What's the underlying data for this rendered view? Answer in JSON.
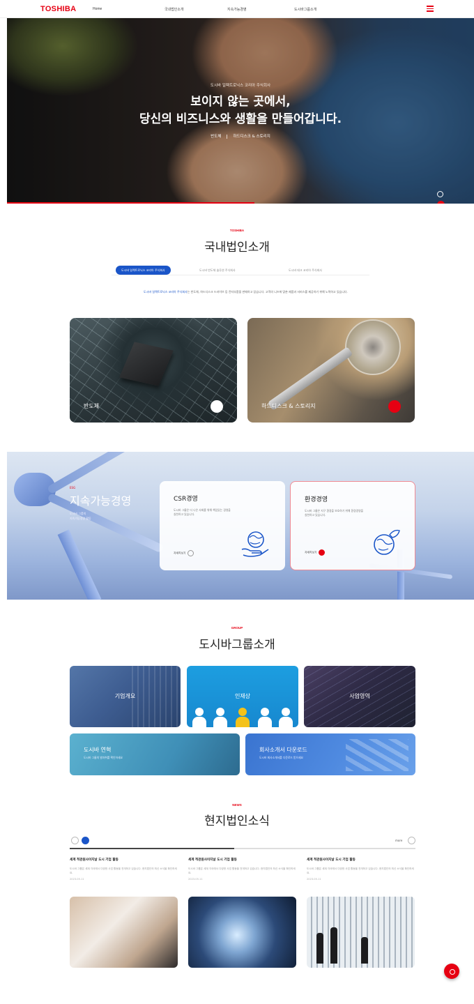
{
  "header": {
    "logo": "TOSHIBA",
    "home": "Home",
    "nav": [
      "국내법인소개",
      "지속가능경영",
      "도시바그룹소개"
    ]
  },
  "hero": {
    "kicker": "도시바 일렉트로닉스 코리아 주식회사",
    "title_line1": "보이지 않는 곳에서,",
    "title_line2": "당신의 비즈니스와 생활을 만들어갑니다.",
    "link1": "반도체",
    "link2": "하드디스크 & 스토리지"
  },
  "domestic": {
    "kicker": "TOSHIBA",
    "title": "국내법인소개",
    "tabs": [
      "도시바 일렉트로닉스 코리아 주식회사",
      "도시바 반도체 솔루션 주식회사",
      "도시바 테크 코리아 주식회사"
    ],
    "intro_highlight": "도시바 일렉트로닉스 코리아 주식회사",
    "intro_rest": "는 반도체, 하드디스크 드라이브 등 전자부품을 판매하고 있습니다. 고객의 니즈에 맞춘 제품과 서비스를 제공하기 위해 노력하고 있습니다.",
    "cards": [
      {
        "label": "반도체"
      },
      {
        "label": "하드디스크 & 스토리지"
      }
    ]
  },
  "sustain": {
    "kicker": "ESG",
    "title": "지속가능경영",
    "desc1": "도시바 그룹의",
    "desc2": "지속가능경영 활동",
    "csr": {
      "title": "CSR경영",
      "desc": "도시바 그룹은 더 나은 사회를 위해 책임있는 경영을 실천하고 있습니다.",
      "more": "자세히보기"
    },
    "env": {
      "title": "환경경영",
      "desc": "도시바 그룹은 지구 환경을 보호하기 위해 환경경영을 실천하고 있습니다.",
      "more": "자세히보기"
    }
  },
  "group": {
    "kicker": "GROUP",
    "title": "도시바그룹소개",
    "cards": [
      {
        "label": "기업개요"
      },
      {
        "label": "인재상"
      },
      {
        "label": "사업영역"
      },
      {
        "label": "도시바 연혁",
        "sub": "도시바 그룹의 발자취를 확인하세요"
      },
      {
        "label": "회사소개서 다운로드",
        "sub": "도시바 회사소개서를 다운로드 받으세요"
      }
    ]
  },
  "news": {
    "kicker": "NEWS",
    "title": "현지법인소식",
    "more": "more",
    "items": [
      {
        "title": "세계 적관원사이지날 도시 기업 활동",
        "desc": "도시바 그룹은 세계 각국에서 다양한 사업 활동을 전개하고 있습니다. 현지법인의 최신 소식을 확인하세요.",
        "date": "2023.05.11"
      },
      {
        "title": "세계 적관원사이지날 도시 기업 활동",
        "desc": "도시바 그룹은 세계 각국에서 다양한 사업 활동을 전개하고 있습니다. 현지법인의 최신 소식을 확인하세요.",
        "date": "2023.05.11"
      },
      {
        "title": "세계 적관원사이지날 도시 기업 활동",
        "desc": "도시바 그룹은 세계 각국에서 다양한 사업 활동을 전개하고 있습니다. 현지법인의 최신 소식을 확인하세요.",
        "date": "2023.05.11"
      }
    ]
  },
  "colors": {
    "brand_red": "#e60012",
    "accent_blue": "#1a55c8"
  }
}
